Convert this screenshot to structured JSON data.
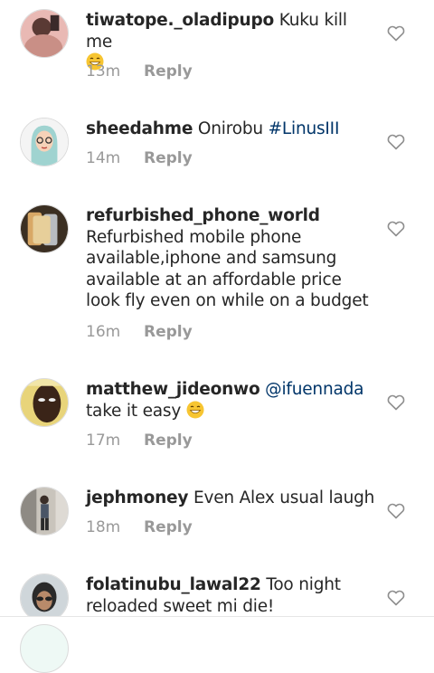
{
  "comments": [
    {
      "username": "tiwatope._oladipupo",
      "text": "Kuku kill me",
      "emoji": "grinning-face-emoji",
      "time": "13m",
      "reply": "Reply"
    },
    {
      "username": "sheedahme",
      "text": "Onirobu",
      "mention": "#LinusIII",
      "time": "14m",
      "reply": "Reply"
    },
    {
      "username": "refurbished_phone_world",
      "text": "Refurbished mobile phone available,iphone and samsung available at an affordable price look fly even on while on a budget",
      "time": "16m",
      "reply": "Reply"
    },
    {
      "username": "matthew_jideonwo",
      "mention": "@ifuennada",
      "text": "take it easy",
      "emoji": "grinning-face-emoji",
      "time": "17m",
      "reply": "Reply"
    },
    {
      "username": "jephmoney",
      "text": "Even Alex usual laugh",
      "time": "18m",
      "reply": "Reply"
    },
    {
      "username": "folatinubu_lawal22",
      "text": "Too night reloaded sweet mi die!"
    }
  ],
  "icons": {
    "like": "heart-outline-icon"
  },
  "colors": {
    "link": "#003569",
    "meta": "#999999",
    "text": "#262626"
  }
}
